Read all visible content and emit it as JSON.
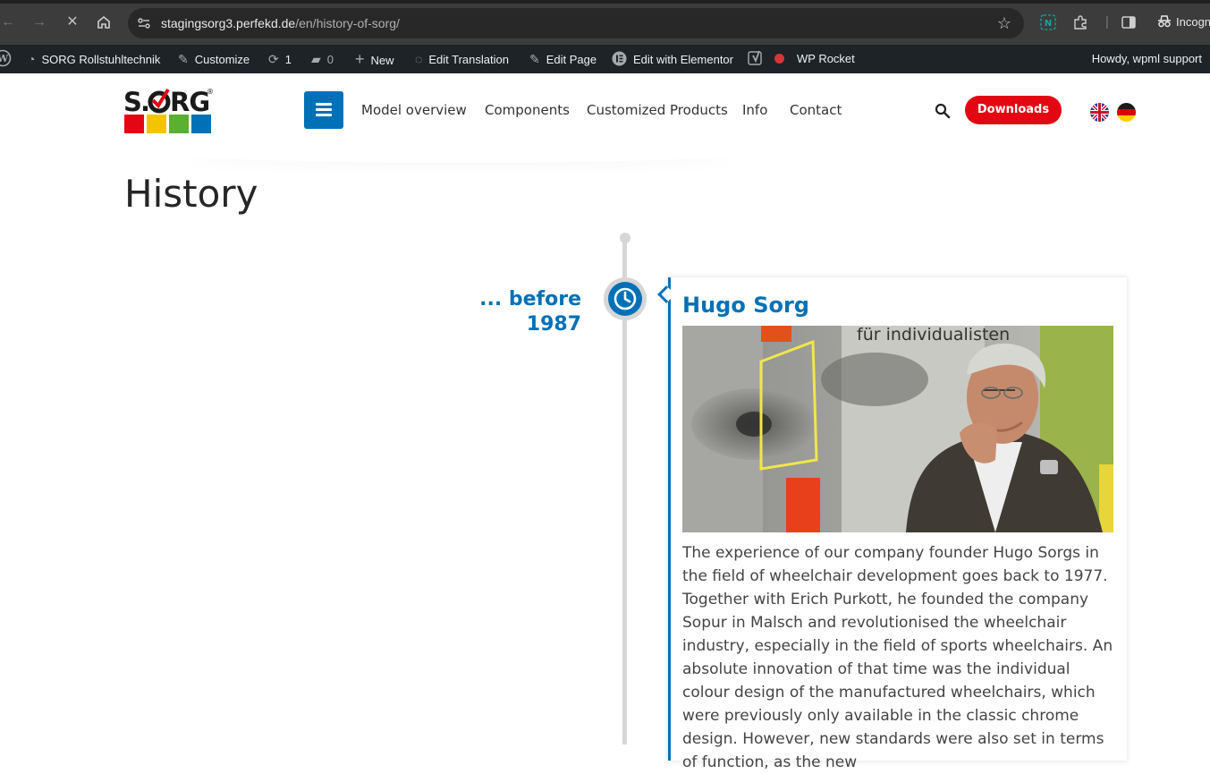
{
  "browser": {
    "url_host": "stagingsorg3.perfekd.de",
    "url_path": "/en/history-of-sorg/",
    "incognito_label": "Incogn"
  },
  "wp_admin_bar": {
    "site_name": "SORG Rollstuhltechnik",
    "customize": "Customize",
    "updates_count": "1",
    "comments_count": "0",
    "new": "New",
    "edit_translation": "Edit Translation",
    "edit_page": "Edit Page",
    "edit_with_elementor": "Edit with Elementor",
    "wp_rocket": "WP Rocket",
    "howdy": "Howdy, wpml support"
  },
  "site_header": {
    "logo_text": "SORG",
    "nav": [
      "Model overview",
      "Components",
      "Customized Products",
      "Info",
      "Contact"
    ],
    "downloads_label": "Downloads",
    "languages": [
      "English",
      "Deutsch"
    ]
  },
  "page": {
    "title": "History"
  },
  "timeline": {
    "entries": [
      {
        "era": "... before 1987",
        "title": "Hugo Sorg",
        "photo_caption_text": "für individualisten",
        "text": "The experience of our company founder Hugo Sorgs in the field of wheelchair development goes back to 1977. Together with Erich Purkott, he founded the company Sopur in Malsch and revolutionised the wheelchair industry, especially in the field of sports wheelchairs. An absolute innovation of that time was the individual colour design of the manufactured wheelchairs, which were previously only available in the classic chrome design. However, new standards were also set in terms of function, as the new"
      }
    ]
  },
  "colors": {
    "brand_blue": "#0071b7",
    "download_red": "#e30613",
    "wp_bar": "#1d2327",
    "browser_bar": "#3c3c3c"
  }
}
